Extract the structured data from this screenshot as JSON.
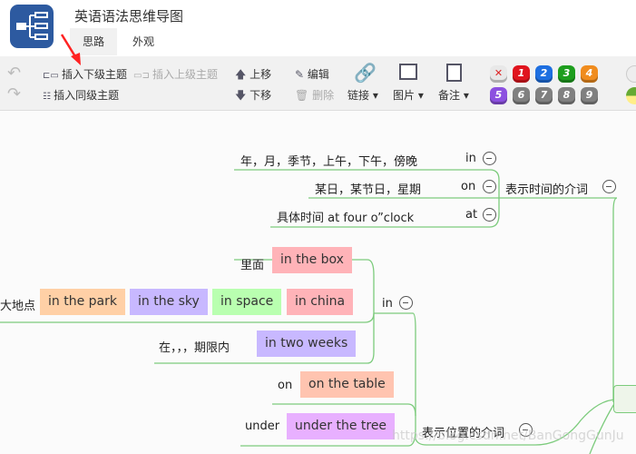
{
  "app": {
    "title": "英语语法思维导图",
    "tabs": [
      "思路",
      "外观"
    ],
    "active_tab": 0
  },
  "toolbar": {
    "undo": "undo-icon",
    "redo": "redo-icon",
    "insert_child": "插入下级主题",
    "insert_parent": "插入上级主题",
    "insert_sibling": "插入同级主题",
    "move_up": "上移",
    "move_down": "下移",
    "edit": "编辑",
    "delete": "删除",
    "link": "链接",
    "image": "图片",
    "note": "备注",
    "priorities": [
      {
        "label": "✕",
        "color": "#e8e8e8"
      },
      {
        "label": "1",
        "color": "#e0141e"
      },
      {
        "label": "2",
        "color": "#1e6fe0"
      },
      {
        "label": "3",
        "color": "#1e9e1e"
      },
      {
        "label": "4",
        "color": "#f08c1e"
      },
      {
        "label": "5",
        "color": "#8c50e0"
      },
      {
        "label": "6",
        "color": "#808080"
      },
      {
        "label": "7",
        "color": "#808080"
      },
      {
        "label": "8",
        "color": "#808080"
      },
      {
        "label": "9",
        "color": "#808080"
      }
    ]
  },
  "map": {
    "time": {
      "label": "表示时间的介词",
      "children": [
        {
          "prep": "in",
          "text": "年，月，季节，上午，下午，傍晚"
        },
        {
          "prep": "on",
          "text": "某日，某节日，星期"
        },
        {
          "prep": "at",
          "text": "具体时间  at four o”clock"
        }
      ]
    },
    "place": {
      "label": "表示位置的介词",
      "in": {
        "prep": "in",
        "inside_label": "里面",
        "inside_example": "in the box",
        "big_label": "大地点",
        "big_examples": [
          "in the park",
          "in the sky",
          "in space",
          "in china"
        ],
        "period_label": "在，，，期限内",
        "period_example": "in two weeks"
      },
      "on": {
        "prep": "on",
        "example": "on the table"
      },
      "under": {
        "prep": "under",
        "example": "under the tree"
      }
    }
  },
  "watermark": "https://blog.csdn.net/BanGongGunJu"
}
